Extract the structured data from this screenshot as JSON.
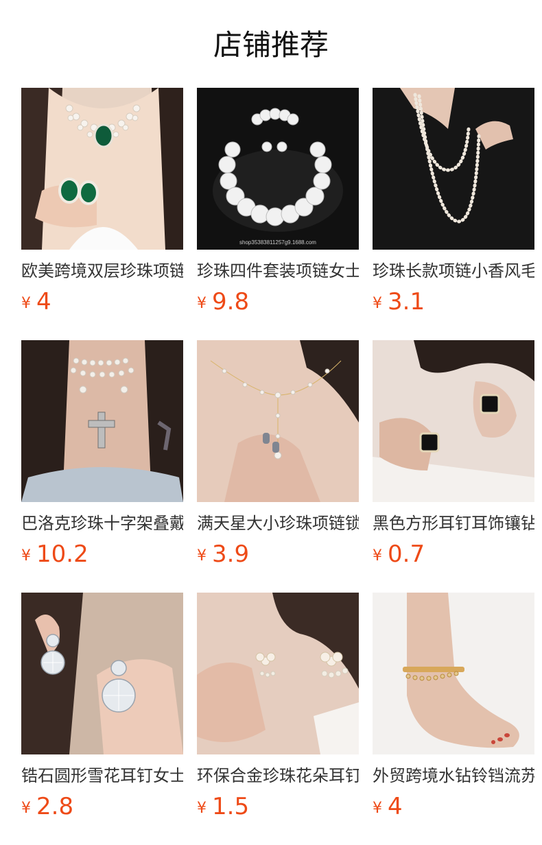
{
  "header": {
    "title": "店铺推荐"
  },
  "currency_symbol": "¥",
  "colors": {
    "price": "#ee4a17",
    "title_text": "#111111",
    "name_text": "#333333"
  },
  "products": [
    {
      "name": "欧美跨境双层珍珠项链",
      "price": "4",
      "image_icon": "pearl-choker-emerald-icon"
    },
    {
      "name": "珍珠四件套装项链女士",
      "price": "9.8",
      "image_icon": "pearl-set-icon",
      "watermark": "shop35383811257g9.1688.com"
    },
    {
      "name": "珍珠长款项链小香风毛衣链",
      "price": "3.1",
      "image_icon": "long-pearl-necklace-icon"
    },
    {
      "name": "巴洛克珍珠十字架叠戴项链",
      "price": "10.2",
      "image_icon": "cross-necklace-icon"
    },
    {
      "name": "满天星大小珍珠项链锁骨链",
      "price": "3.9",
      "image_icon": "y-pearl-necklace-icon"
    },
    {
      "name": "黑色方形耳钉耳饰镶钻",
      "price": "0.7",
      "image_icon": "black-square-earring-icon"
    },
    {
      "name": "锆石圆形雪花耳钉女士",
      "price": "2.8",
      "image_icon": "zircon-earring-icon"
    },
    {
      "name": "环保合金珍珠花朵耳钉",
      "price": "1.5",
      "image_icon": "flower-pearl-earring-icon"
    },
    {
      "name": "外贸跨境水钻铃铛流苏脚链",
      "price": "4",
      "image_icon": "anklet-icon"
    }
  ]
}
